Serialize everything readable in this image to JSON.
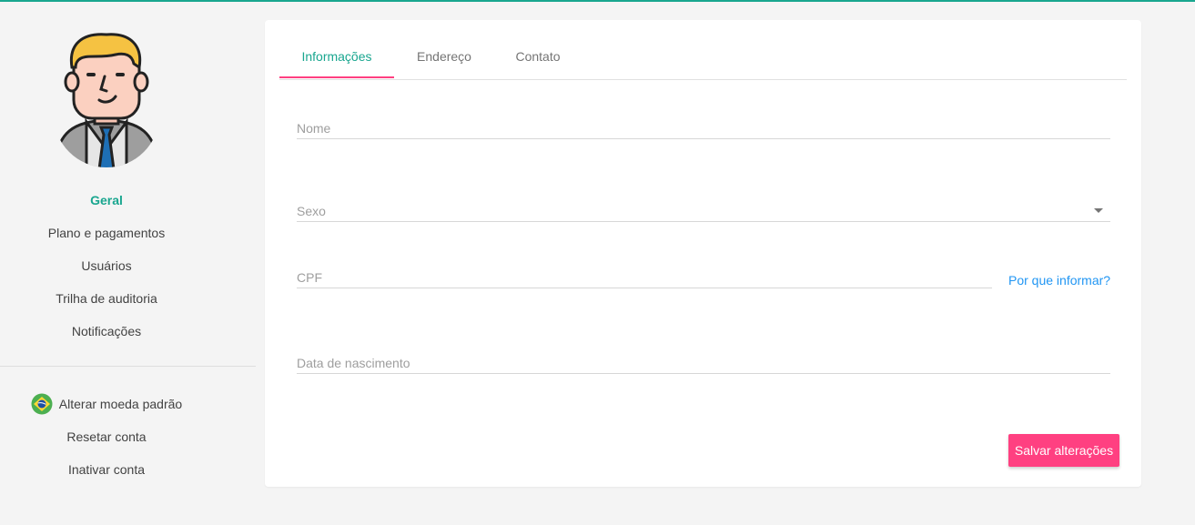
{
  "colors": {
    "accent": "#19a68f",
    "pink": "#ff4081",
    "link": "#2196f3"
  },
  "sidebar": {
    "avatar_icon": "businessman-avatar-icon",
    "nav": [
      {
        "label": "Geral",
        "active": true
      },
      {
        "label": "Plano e pagamentos"
      },
      {
        "label": "Usuários"
      },
      {
        "label": "Trilha de auditoria"
      },
      {
        "label": "Notificações"
      }
    ],
    "currency": {
      "label": "Alterar moeda padrão",
      "icon": "brazil-flag-icon"
    },
    "actions": [
      {
        "label": "Resetar conta"
      },
      {
        "label": "Inativar conta"
      }
    ]
  },
  "card": {
    "tabs": [
      {
        "label": "Informações",
        "active": true
      },
      {
        "label": "Endereço"
      },
      {
        "label": "Contato"
      }
    ],
    "fields": {
      "nome": {
        "placeholder": "Nome",
        "value": ""
      },
      "sexo": {
        "placeholder": "Sexo",
        "value": ""
      },
      "cpf": {
        "placeholder": "CPF",
        "value": ""
      },
      "nascimento": {
        "placeholder": "Data de nascimento",
        "value": ""
      }
    },
    "why_link": "Por que informar?",
    "save_label": "Salvar alterações"
  }
}
